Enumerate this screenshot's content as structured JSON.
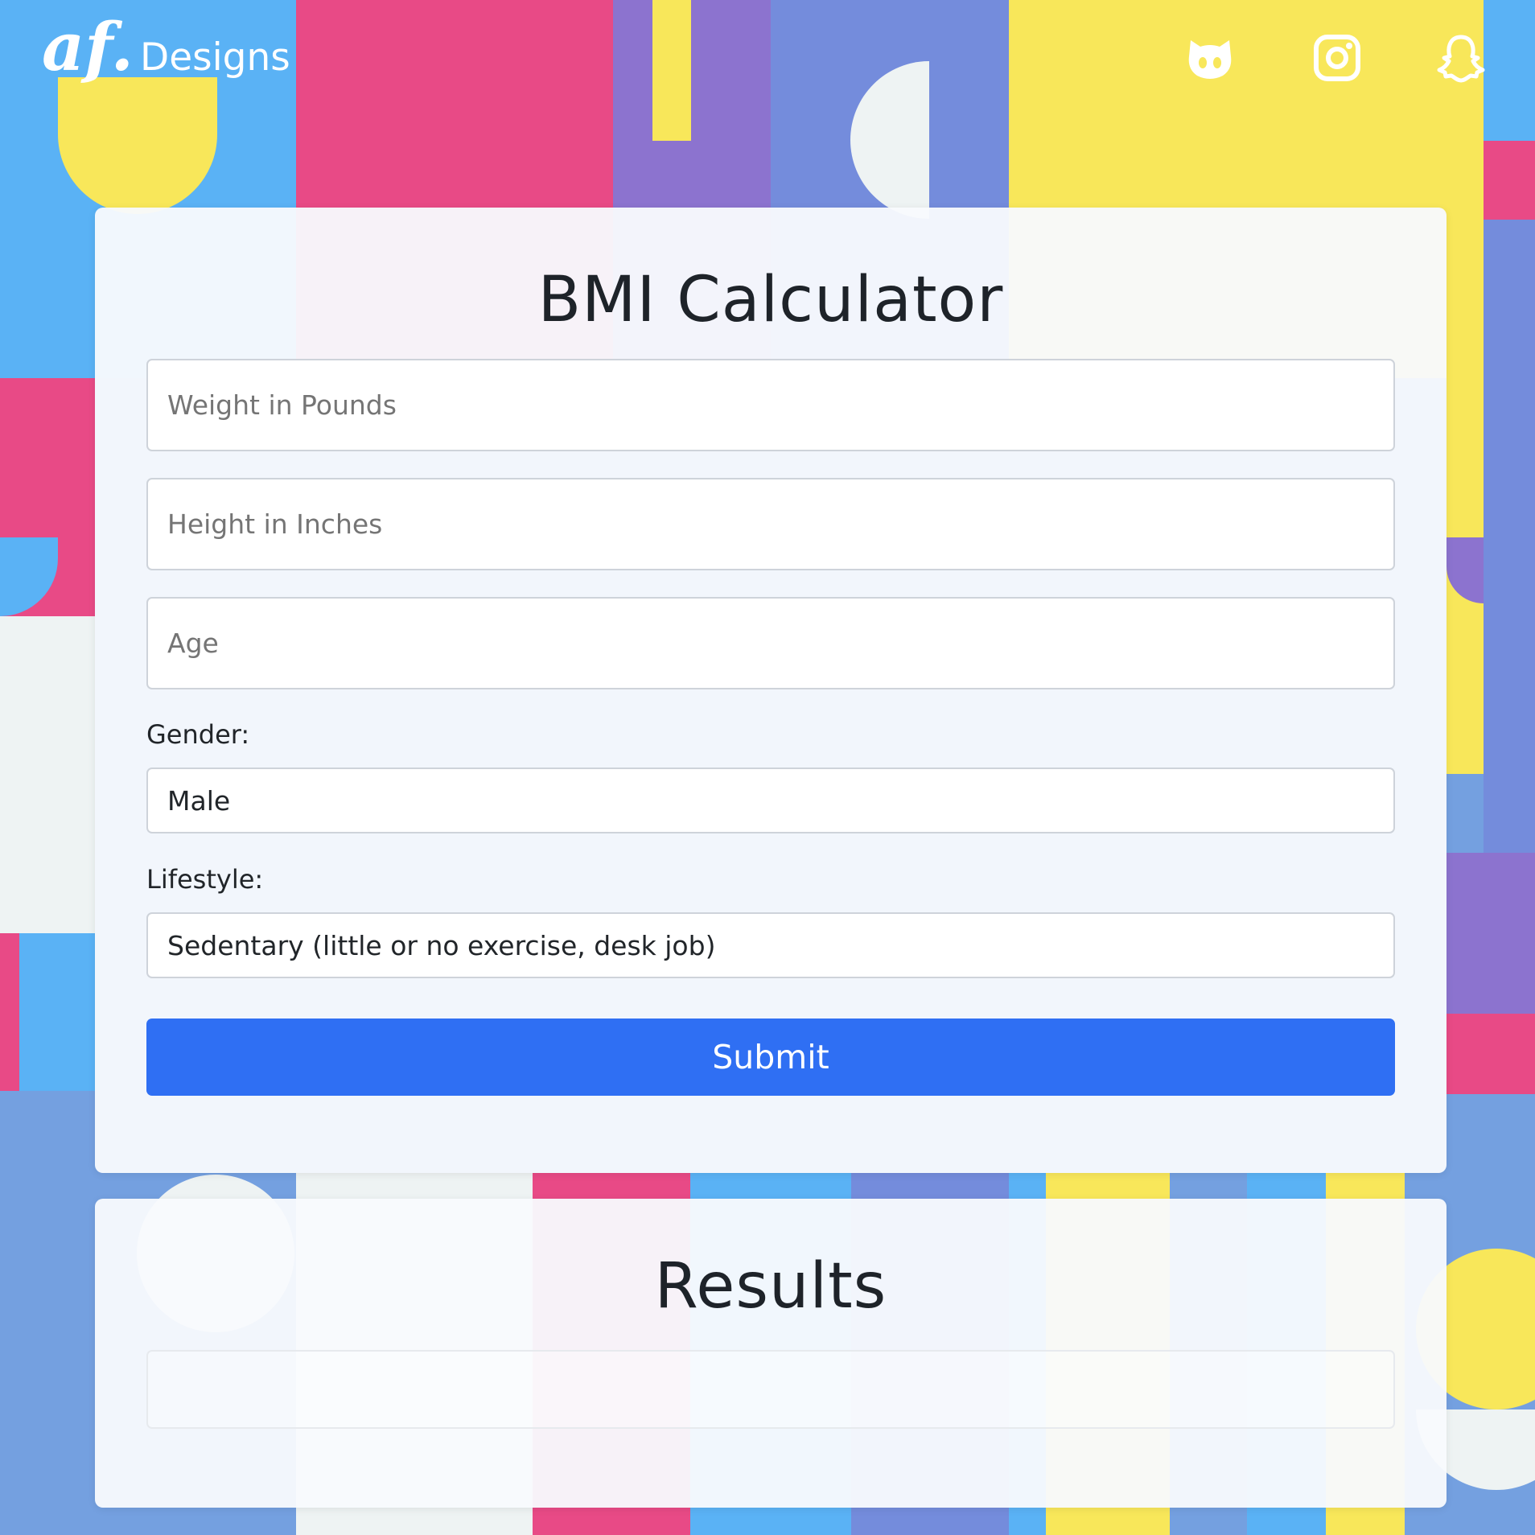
{
  "header": {
    "logo_mark": "af.",
    "logo_text": "Designs",
    "social_icons": [
      "github-icon",
      "instagram-icon",
      "snapchat-icon"
    ]
  },
  "form": {
    "title": "BMI Calculator",
    "weight_placeholder": "Weight in Pounds",
    "height_placeholder": "Height in Inches",
    "age_placeholder": "Age",
    "gender_label": "Gender:",
    "gender_value": "Male",
    "lifestyle_label": "Lifestyle:",
    "lifestyle_value": "Sedentary (little or no exercise, desk job)",
    "submit_label": "Submit"
  },
  "results": {
    "title": "Results",
    "value": ""
  },
  "colors": {
    "blue": "#5ab2f5",
    "pink": "#e84a86",
    "purple": "#8c73cf",
    "periwinkle": "#748cdc",
    "yellow": "#f8e75a",
    "offwhite": "#eef3f3",
    "accent": "#2f6ff3"
  }
}
